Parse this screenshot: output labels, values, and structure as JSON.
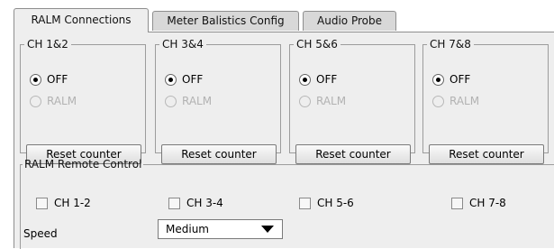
{
  "tabs": [
    {
      "label": "RALM Connections",
      "active": true
    },
    {
      "label": "Meter Balistics Config",
      "active": false
    },
    {
      "label": "Audio Probe",
      "active": false
    }
  ],
  "channels": [
    {
      "title": "CH 1&2",
      "off_label": "OFF",
      "ralm_label": "RALM",
      "selected": "OFF",
      "reset_label": "Reset counter"
    },
    {
      "title": "CH 3&4",
      "off_label": "OFF",
      "ralm_label": "RALM",
      "selected": "OFF",
      "reset_label": "Reset counter"
    },
    {
      "title": "CH 5&6",
      "off_label": "OFF",
      "ralm_label": "RALM",
      "selected": "OFF",
      "reset_label": "Reset counter"
    },
    {
      "title": "CH 7&8",
      "off_label": "OFF",
      "ralm_label": "RALM",
      "selected": "OFF",
      "reset_label": "Reset counter"
    }
  ],
  "remote": {
    "title": "RALM Remote Control",
    "checkboxes": [
      {
        "label": "CH 1-2",
        "checked": false
      },
      {
        "label": "CH 3-4",
        "checked": false
      },
      {
        "label": "CH 5-6",
        "checked": false
      },
      {
        "label": "CH 7-8",
        "checked": false
      }
    ],
    "speed_label": "Speed",
    "speed_value": "Medium"
  }
}
